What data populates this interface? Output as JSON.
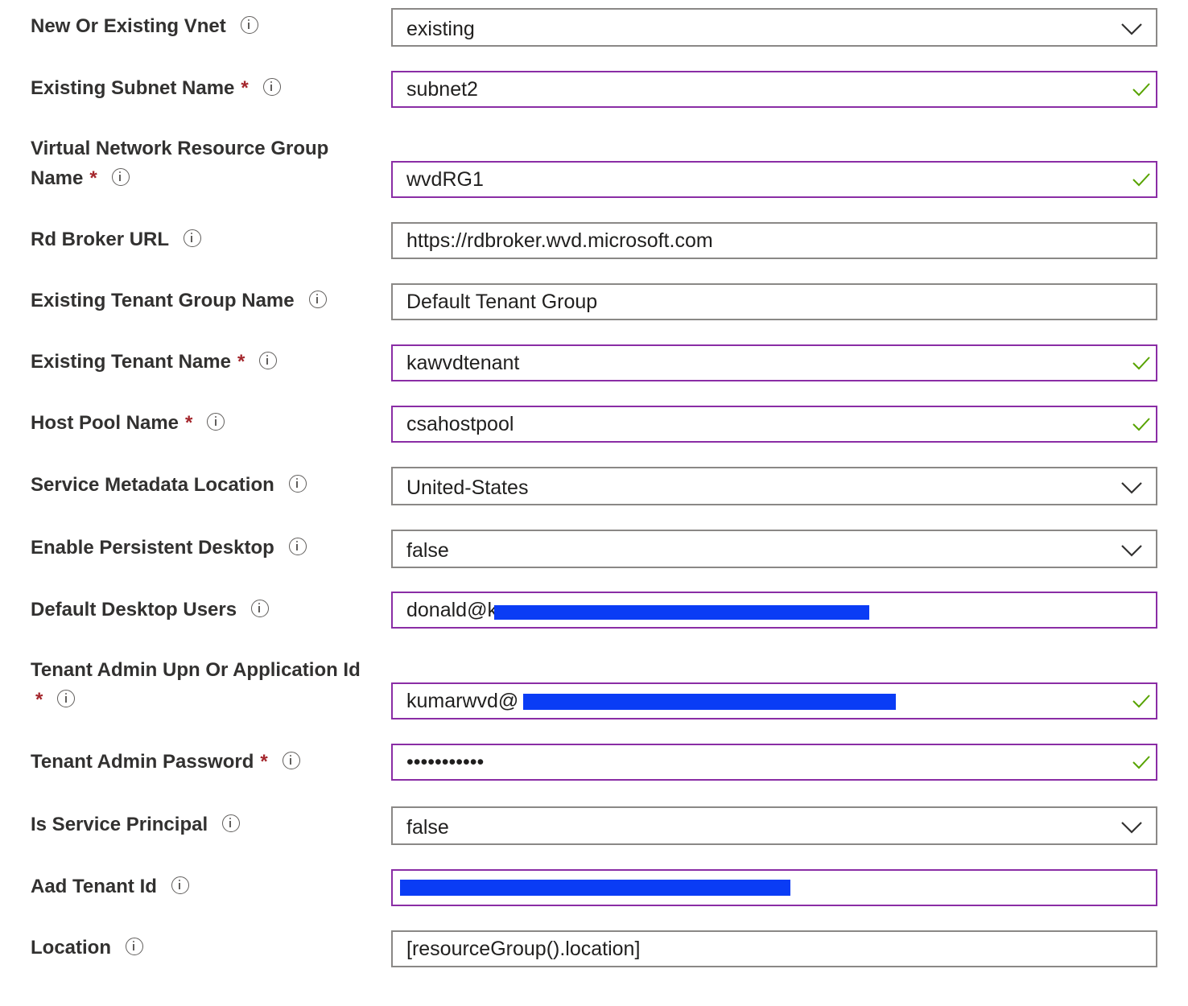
{
  "form": {
    "fields": {
      "vnet": {
        "label": "New Or Existing Vnet",
        "value": "existing"
      },
      "subnet": {
        "label": "Existing Subnet Name",
        "value": "subnet2"
      },
      "vnet_rg": {
        "label_line1": "Virtual Network Resource Group",
        "label_line2": "Name",
        "value": "wvdRG1"
      },
      "broker": {
        "label": "Rd Broker URL",
        "value": "https://rdbroker.wvd.microsoft.com"
      },
      "tenant_group": {
        "label": "Existing Tenant Group Name",
        "value": "Default Tenant Group"
      },
      "tenant_name": {
        "label": "Existing Tenant Name",
        "value": "kawvdtenant"
      },
      "host_pool": {
        "label": "Host Pool Name",
        "value": "csahostpool"
      },
      "metadata_location": {
        "label": "Service Metadata Location",
        "value": "United-States"
      },
      "persistent": {
        "label": "Enable Persistent Desktop",
        "value": "false"
      },
      "desktop_users": {
        "label": "Default Desktop Users",
        "value": "donald@k"
      },
      "admin_upn": {
        "label": "Tenant Admin Upn Or Application Id",
        "value": "kumarwvd@"
      },
      "admin_password": {
        "label": "Tenant Admin Password",
        "value": "•••••••••••"
      },
      "service_principal": {
        "label": "Is Service Principal",
        "value": "false"
      },
      "aad_tenant": {
        "label": "Aad Tenant Id",
        "value": ""
      },
      "location": {
        "label": "Location",
        "value": "[resourceGroup().location]"
      }
    },
    "required_marker": "*"
  },
  "colors": {
    "label": "#323130",
    "required": "#a4262c",
    "valid_border": "#8a2da5",
    "default_border": "#8a8886",
    "check": "#57a300",
    "redaction": "#0a3cf5"
  },
  "icons": {
    "info": "info-icon",
    "valid": "checkmark-icon",
    "dropdown": "chevron-down-icon"
  }
}
